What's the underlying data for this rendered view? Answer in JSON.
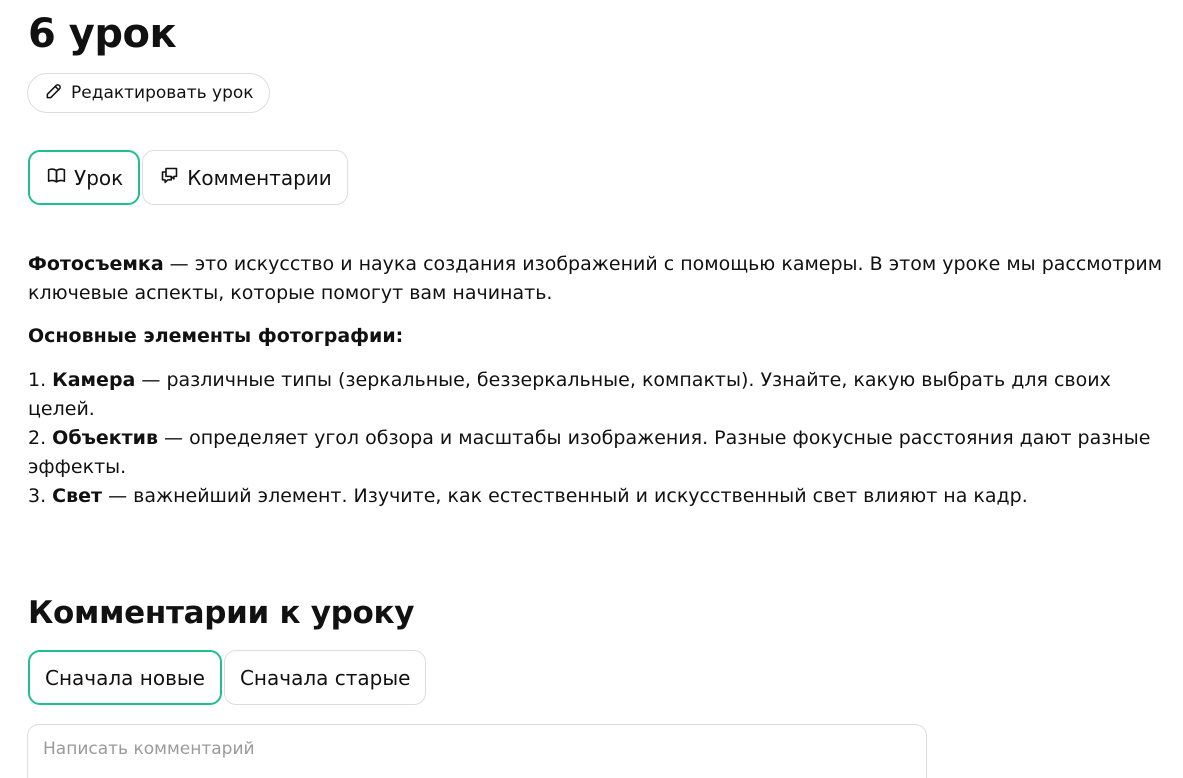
{
  "lesson": {
    "title": "6 урок",
    "edit_label": "Редактировать урок"
  },
  "tabs": [
    {
      "label": "Урок",
      "icon": "book-icon",
      "active": true
    },
    {
      "label": "Комментарии",
      "icon": "chat-icon",
      "active": false
    }
  ],
  "content": {
    "intro_term": "Фотосъемка",
    "intro_text": " — это искусство и наука создания изображений с помощью камеры. В этом уроке мы рассмотрим ключевые аспекты, которые помогут вам начинать.",
    "subheading": "Основные элементы фотографии:",
    "items": [
      {
        "num": "1. ",
        "term": "Камера",
        "text": " — различные типы (зеркальные, беззеркальные, компакты). Узнайте, какую выбрать для своих целей."
      },
      {
        "num": "2. ",
        "term": "Объектив",
        "text": " — определяет угол обзора и масштабы изображения. Разные фокусные расстояния дают разные эффекты."
      },
      {
        "num": "3. ",
        "term": "Свет",
        "text": " — важнейший элемент. Изучите, как естественный и искусственный свет влияют на кадр."
      }
    ]
  },
  "comments": {
    "title": "Комментарии к уроку",
    "sort_options": [
      {
        "label": "Сначала новые",
        "active": true
      },
      {
        "label": "Сначала старые",
        "active": false
      }
    ],
    "input_placeholder": "Написать комментарий",
    "input_value": ""
  },
  "colors": {
    "accent": "#1fbf8e",
    "border": "#dddddd",
    "text": "#111111",
    "placeholder": "#9a9a9a"
  }
}
